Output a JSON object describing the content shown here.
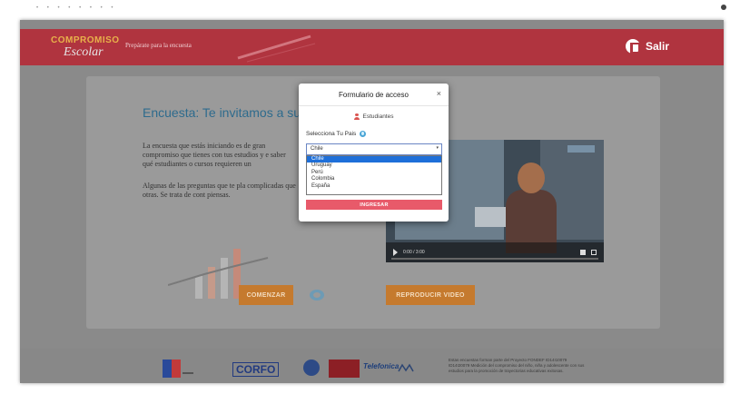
{
  "header": {
    "logo_top": "COMPROMISO",
    "logo_bottom": "Escolar",
    "tagline": "Prepárate para la encuesta",
    "exit_label": "Salir"
  },
  "main": {
    "title": "Encuesta: Te invitamos a super",
    "paragraph1": "La encuesta que estás iniciando es de gran compromiso que tienes con tus estudios y e saber qué estudiantes o cursos requieren un",
    "paragraph2": "Algunas de las preguntas que te pla complicadas que otras. Se trata de cont piensas.",
    "start_button": "COMENZAR",
    "video_button": "REPRODUCIR VIDEO",
    "video_time": "0:00 / 3:00"
  },
  "modal": {
    "title": "Formulario de acceso",
    "close_symbol": "×",
    "role_label": "Estudiantes",
    "country_label": "Selecciona Tu Pais",
    "selected_country": "Chile",
    "countries": [
      "Chile",
      "Uruguay",
      "Perú",
      "Colombia",
      "España"
    ],
    "submit_label": "INGRESAR"
  },
  "footer": {
    "corfo_label": "CORFO",
    "telefonica_label": "Telefonica",
    "text": "Estas encuestas forman parte del Proyecto FONDEF ID14I10079 ID14I20079 Medición del compromiso del niño, niña y adolescente con sus estudios para la promoción de trayectorias educativas exitosas."
  },
  "colors": {
    "header_red": "#b0343f",
    "accent_orange": "#c57a2e",
    "submit_pink": "#e85a6a",
    "title_blue": "#2e6b8d",
    "select_highlight": "#1e6fd9"
  }
}
